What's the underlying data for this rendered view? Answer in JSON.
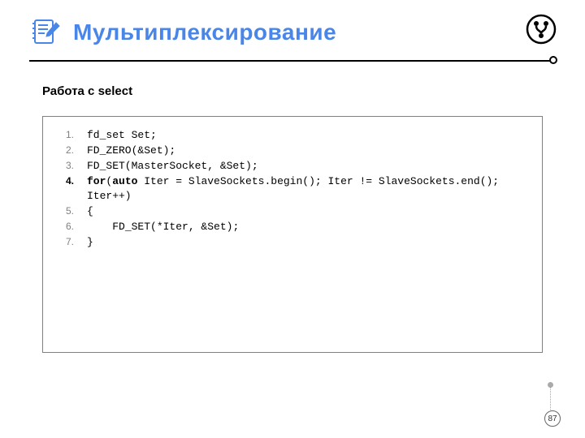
{
  "header": {
    "title": "Мультиплексирование",
    "icon": "notepad-pencil-icon",
    "corner_icon": "branch-circle-icon"
  },
  "subtitle": "Работа с select",
  "code": {
    "highlighted_line": 4,
    "lines": [
      {
        "n": "1.",
        "segments": [
          {
            "t": "fd_set Set;"
          }
        ]
      },
      {
        "n": "2.",
        "segments": [
          {
            "t": "FD_ZERO(&Set);"
          }
        ]
      },
      {
        "n": "3.",
        "segments": [
          {
            "t": "FD_SET(MasterSocket, &Set);"
          }
        ]
      },
      {
        "n": "4.",
        "segments": [
          {
            "t": "for",
            "b": true
          },
          {
            "t": "("
          },
          {
            "t": "auto",
            "b": true
          },
          {
            "t": " Iter = SlaveSockets.begin(); Iter != SlaveSockets.end(); Iter++)"
          }
        ]
      },
      {
        "n": "5.",
        "segments": [
          {
            "t": "{"
          }
        ]
      },
      {
        "n": "6.",
        "segments": [
          {
            "t": "    FD_SET(*Iter, &Set);"
          }
        ]
      },
      {
        "n": "7.",
        "segments": [
          {
            "t": "}"
          }
        ]
      }
    ]
  },
  "page_number": "87"
}
